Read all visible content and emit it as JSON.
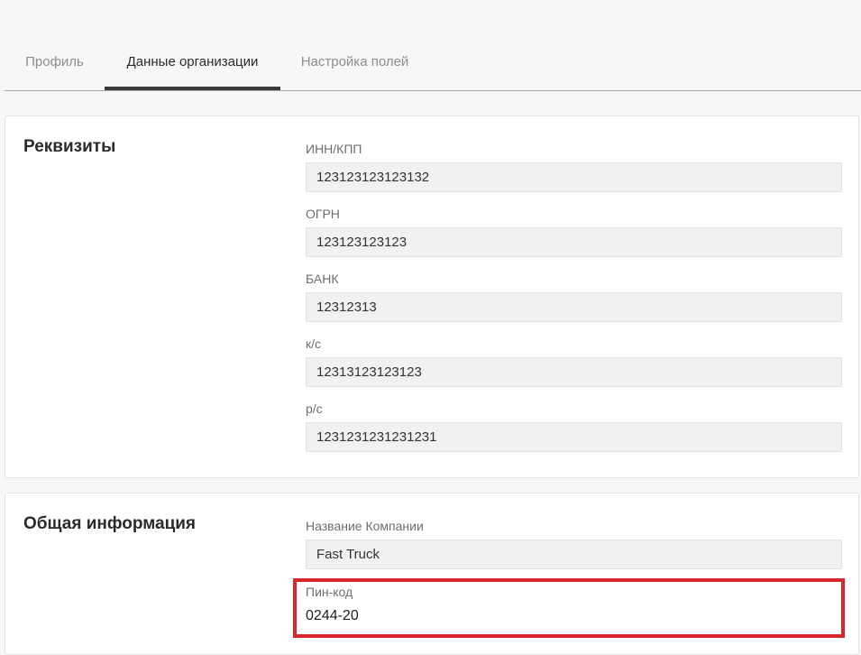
{
  "tabs": [
    {
      "label": "Профиль"
    },
    {
      "label": "Данные организации"
    },
    {
      "label": "Настройка полей"
    }
  ],
  "requisites": {
    "title": "Реквизиты",
    "fields": [
      {
        "label": "ИНН/КПП",
        "value": "123123123123132"
      },
      {
        "label": "ОГРН",
        "value": "123123123123"
      },
      {
        "label": "БАНК",
        "value": "12312313"
      },
      {
        "label": "к/с",
        "value": "12313123123123"
      },
      {
        "label": "р/с",
        "value": "1231231231231231"
      }
    ]
  },
  "general": {
    "title": "Общая информация",
    "company": {
      "label": "Название Компании",
      "value": "Fast Truck"
    },
    "pin": {
      "label": "Пин-код",
      "value": "0244-20"
    }
  },
  "colors": {
    "highlight": "#d7262e",
    "active_tab_underline": "#3a3a3a"
  }
}
